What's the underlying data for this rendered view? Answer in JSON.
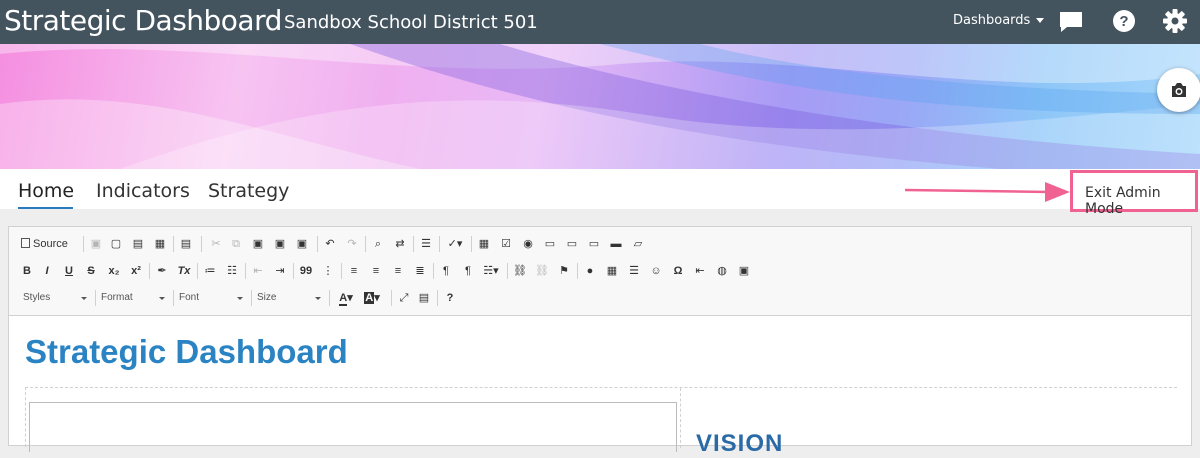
{
  "header": {
    "app_title": "Strategic Dashboard",
    "district": "Sandbox School District 501",
    "dashboards_menu": "Dashboards",
    "icons": [
      "chat-icon",
      "help-icon",
      "gear-icon"
    ]
  },
  "banner": {
    "camera_icon": "camera-icon"
  },
  "nav": {
    "tabs": [
      {
        "label": "Home",
        "active": true
      },
      {
        "label": "Indicators",
        "active": false
      },
      {
        "label": "Strategy",
        "active": false
      }
    ],
    "exit_admin": "Exit Admin Mode"
  },
  "toolbar": {
    "source_label": "Source",
    "row1": [
      "save",
      "new-page",
      "preview",
      "print",
      "templates",
      "cut",
      "copy",
      "paste",
      "paste-text",
      "paste-word",
      "undo",
      "redo",
      "find",
      "replace",
      "select-all",
      "spellcheck",
      "form",
      "checkbox",
      "radio",
      "textfield",
      "textarea",
      "select",
      "button",
      "hidden-field"
    ],
    "row2": [
      "B",
      "I",
      "U",
      "S",
      "x₂",
      "x²",
      "¶",
      "Tx",
      "ordered-list",
      "bullet-list",
      "outdent",
      "indent",
      "99",
      "div",
      "align-left",
      "align-center",
      "align-right",
      "justify",
      "ltr",
      "rtl",
      "language",
      "link",
      "unlink",
      "anchor",
      "flash",
      "table",
      "horizontal-line",
      "smiley",
      "Ω",
      "page-break",
      "iframe",
      "image"
    ],
    "styles_label": "Styles",
    "format_label": "Format",
    "font_label": "Font",
    "size_label": "Size",
    "help_label": "?"
  },
  "content": {
    "title": "Strategic Dashboard",
    "vision": "VISION"
  },
  "colors": {
    "header_bg": "#44545f",
    "accent": "#2a83c2",
    "highlight": "#f06292"
  }
}
